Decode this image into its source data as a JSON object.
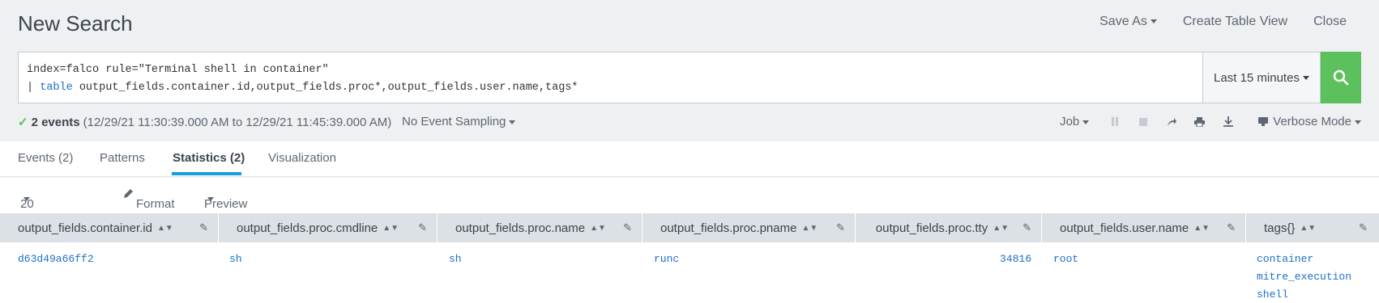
{
  "header": {
    "title": "New Search",
    "save_as": "Save As",
    "create_table_view": "Create Table View",
    "close": "Close"
  },
  "search": {
    "line1": "index=falco rule=\"Terminal shell in container\"",
    "line2_pipe": "| ",
    "line2_cmd": "table",
    "line2_rest": " output_fields.container.id,output_fields.proc*,output_fields.user.name,tags*",
    "time_range": "Last 15 minutes"
  },
  "status": {
    "events": "2 events",
    "range": "(12/29/21 11:30:39.000 AM to 12/29/21 11:45:39.000 AM)",
    "sampling": "No Event Sampling",
    "job": "Job",
    "mode": "Verbose Mode"
  },
  "tabs": [
    {
      "label": "Events (2)"
    },
    {
      "label": "Patterns"
    },
    {
      "label": "Statistics (2)"
    },
    {
      "label": "Visualization"
    }
  ],
  "toolbar": {
    "per_page": "20 Per Page",
    "format": "Format",
    "preview": "Preview"
  },
  "columns": [
    "output_fields.container.id",
    "output_fields.proc.cmdline",
    "output_fields.proc.name",
    "output_fields.proc.pname",
    "output_fields.proc.tty",
    "output_fields.user.name",
    "tags{}"
  ],
  "row": {
    "container_id": "d63d49a66ff2",
    "cmdline": "sh",
    "name": "sh",
    "pname": "runc",
    "tty": "34816",
    "user": "root",
    "tags": [
      "container",
      "mitre_execution",
      "shell"
    ]
  },
  "colors": {
    "accent": "#1a9ce0",
    "search_button": "#5cc05c",
    "link": "#1d6fc7"
  }
}
